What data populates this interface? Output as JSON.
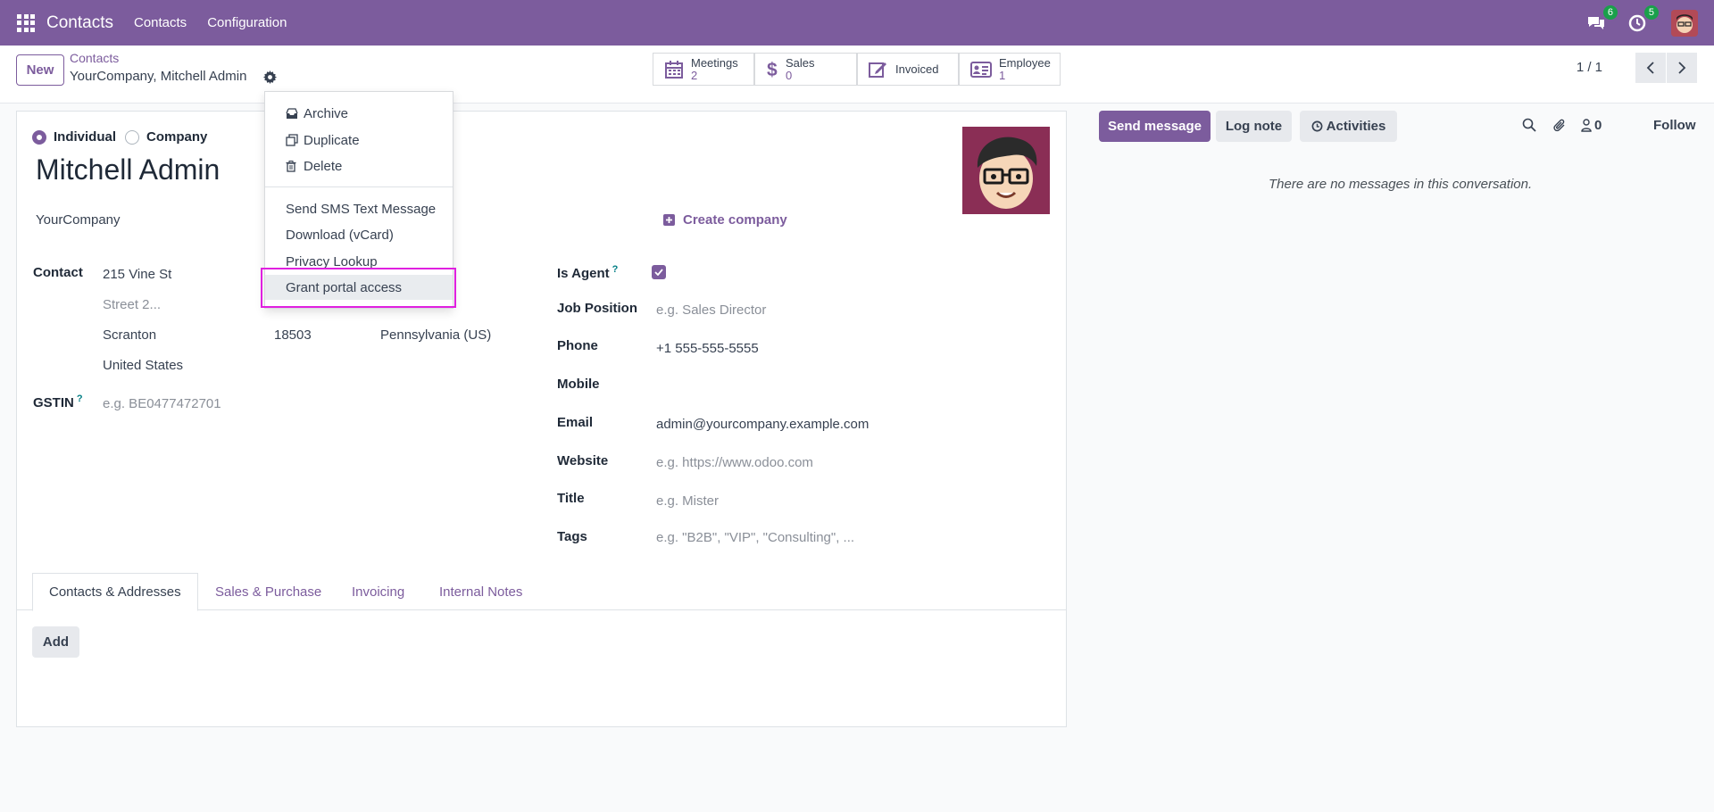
{
  "navbar": {
    "brand": "Contacts",
    "menu_contacts": "Contacts",
    "menu_configuration": "Configuration",
    "messages_count": "6",
    "activities_count": "5"
  },
  "control_panel": {
    "new_label": "New",
    "breadcrumb_parent": "Contacts",
    "breadcrumb_current": "YourCompany, Mitchell Admin",
    "smart_buttons": [
      {
        "label": "Meetings",
        "value": "2",
        "icon": "calendar-icon"
      },
      {
        "label": "Sales",
        "value": "0",
        "icon": "dollar-icon"
      },
      {
        "label": "Invoiced",
        "value": "",
        "icon": "pencil-square-icon"
      },
      {
        "label": "Employee",
        "value": "1",
        "icon": "id-card-icon"
      }
    ],
    "pager": "1 / 1"
  },
  "form": {
    "type_individual": "Individual",
    "type_company": "Company",
    "name": "Mitchell Admin",
    "company": "YourCompany",
    "create_company": "Create company",
    "contact_label": "Contact",
    "street": "215 Vine St",
    "street2_placeholder": "Street 2...",
    "city": "Scranton",
    "zip": "18503",
    "state": "Pennsylvania (US)",
    "country": "United States",
    "gstin_label": "GSTIN",
    "gstin_placeholder": "e.g. BE0477472701",
    "is_agent_label": "Is Agent",
    "job_position_label": "Job Position",
    "job_position_placeholder": "e.g. Sales Director",
    "phone_label": "Phone",
    "phone": "+1 555-555-5555",
    "mobile_label": "Mobile",
    "email_label": "Email",
    "email": "admin@yourcompany.example.com",
    "website_label": "Website",
    "website_placeholder": "e.g. https://www.odoo.com",
    "title_label": "Title",
    "title_placeholder": "e.g. Mister",
    "tags_label": "Tags",
    "tags_placeholder": "e.g. \"B2B\", \"VIP\", \"Consulting\", ...",
    "help_mark": "?"
  },
  "tabs": [
    {
      "label": "Contacts & Addresses"
    },
    {
      "label": "Sales & Purchase"
    },
    {
      "label": "Invoicing"
    },
    {
      "label": "Internal Notes"
    }
  ],
  "add_label": "Add",
  "chatter": {
    "send_message": "Send message",
    "log_note": "Log note",
    "activities": "Activities",
    "followers_count": "0",
    "follow": "Follow",
    "no_messages": "There are no messages in this conversation."
  },
  "dropdown": {
    "archive": "Archive",
    "duplicate": "Duplicate",
    "delete": "Delete",
    "send_sms": "Send SMS Text Message",
    "download_vcard": "Download (vCard)",
    "privacy_lookup": "Privacy Lookup",
    "grant_portal": "Grant portal access"
  },
  "colors": {
    "brand": "#7c5c9d",
    "badge": "#1aa04b",
    "highlight": "#e020e0"
  }
}
